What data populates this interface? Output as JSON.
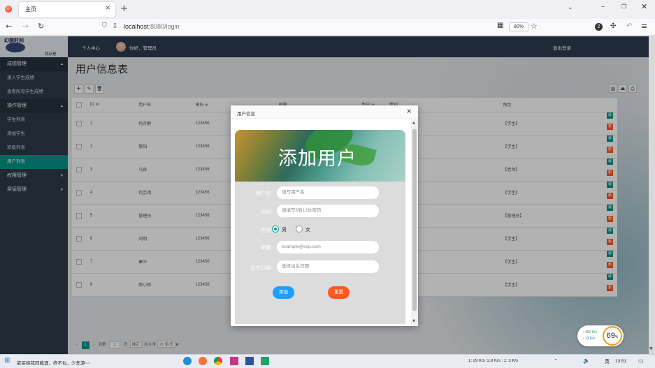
{
  "browser": {
    "tab_title": "主页",
    "url_host": "localhost",
    "url_path": ":8080/login",
    "zoom": "80%",
    "ext_badge": "2"
  },
  "sidebar": {
    "logo_text": "幻想时间",
    "logo_sub": "我存是",
    "items": [
      {
        "label": "成绩管理",
        "type": "header",
        "arrow": "▲"
      },
      {
        "label": "录入学生成绩",
        "type": "item"
      },
      {
        "label": "查看所有学生成绩",
        "type": "item"
      },
      {
        "label": "操作管理",
        "type": "header",
        "arrow": "▲"
      },
      {
        "label": "学生列表",
        "type": "item"
      },
      {
        "label": "添加学生",
        "type": "item"
      },
      {
        "label": "班级列表",
        "type": "item"
      },
      {
        "label": "用户列表",
        "type": "active"
      },
      {
        "label": "权限管理",
        "type": "header2",
        "arrow": "▼"
      },
      {
        "label": "奖惩管理",
        "type": "header2",
        "arrow": "▼"
      }
    ]
  },
  "topbar": {
    "personal": "个人中心",
    "greeting": "你好，管理员",
    "logout": "退出登录"
  },
  "main": {
    "title": "用户信息表",
    "columns": [
      "ID ≑",
      "用户名",
      "密码 ≑",
      "邮箱",
      "生日 ≑",
      "性别",
      "角色"
    ],
    "rows": [
      {
        "id": "1",
        "name": "何亦静",
        "pwd": "123456",
        "role": "【学生】"
      },
      {
        "id": "2",
        "name": "黎阳",
        "pwd": "123456",
        "role": "【学生】"
      },
      {
        "id": "3",
        "name": "马良",
        "pwd": "123456",
        "role": "【老师】"
      },
      {
        "id": "4",
        "name": "何芸晴",
        "pwd": "123456",
        "role": "【学生】"
      },
      {
        "id": "5",
        "name": "管理员",
        "pwd": "123456",
        "role": "【管理员】"
      },
      {
        "id": "6",
        "name": "刘明",
        "pwd": "123456",
        "role": "【学生】"
      },
      {
        "id": "7",
        "name": "秦王",
        "pwd": "123456",
        "role": "【学生】"
      },
      {
        "id": "8",
        "name": "颜小娇",
        "pwd": "123456",
        "role": "【学生】"
      }
    ],
    "edit_label": "编辑",
    "delete_label": "删除",
    "pager": {
      "current": "1",
      "goto": "到第",
      "page_input": "1",
      "page_unit": "页",
      "confirm": "确定",
      "total": "共 8 条",
      "per_page": "20 条/页"
    }
  },
  "modal": {
    "title": "用户信息",
    "banner": "添加用户",
    "fields": {
      "username": {
        "label": "用户名",
        "placeholder": "填写用户名"
      },
      "password": {
        "label": "密码",
        "placeholder": "请填写6到12位密码"
      },
      "gender": {
        "label": "性别",
        "male": "男",
        "female": "女"
      },
      "email": {
        "label": "邮箱",
        "placeholder": "example@exp.com"
      },
      "birthday": {
        "label": "出生日期",
        "placeholder": "选择出生日期"
      }
    },
    "add_button": "添加",
    "reset_button": "重置"
  },
  "netwidget": {
    "up": "452 K/s",
    "down": "13 K/s",
    "percent": "69",
    "unit": "%"
  },
  "taskbar": {
    "song": "欲买桂花同载酒，终不似，少年游~~",
    "tray_text": "1: 29 K/s :2.8 K/s : 1: 3 K/s",
    "lang": "英",
    "time": "13:51"
  },
  "colors": {
    "teal": "#009688",
    "orange": "#ff5722",
    "blue": "#1e9fff",
    "sidebar": "#2e3a4a"
  }
}
